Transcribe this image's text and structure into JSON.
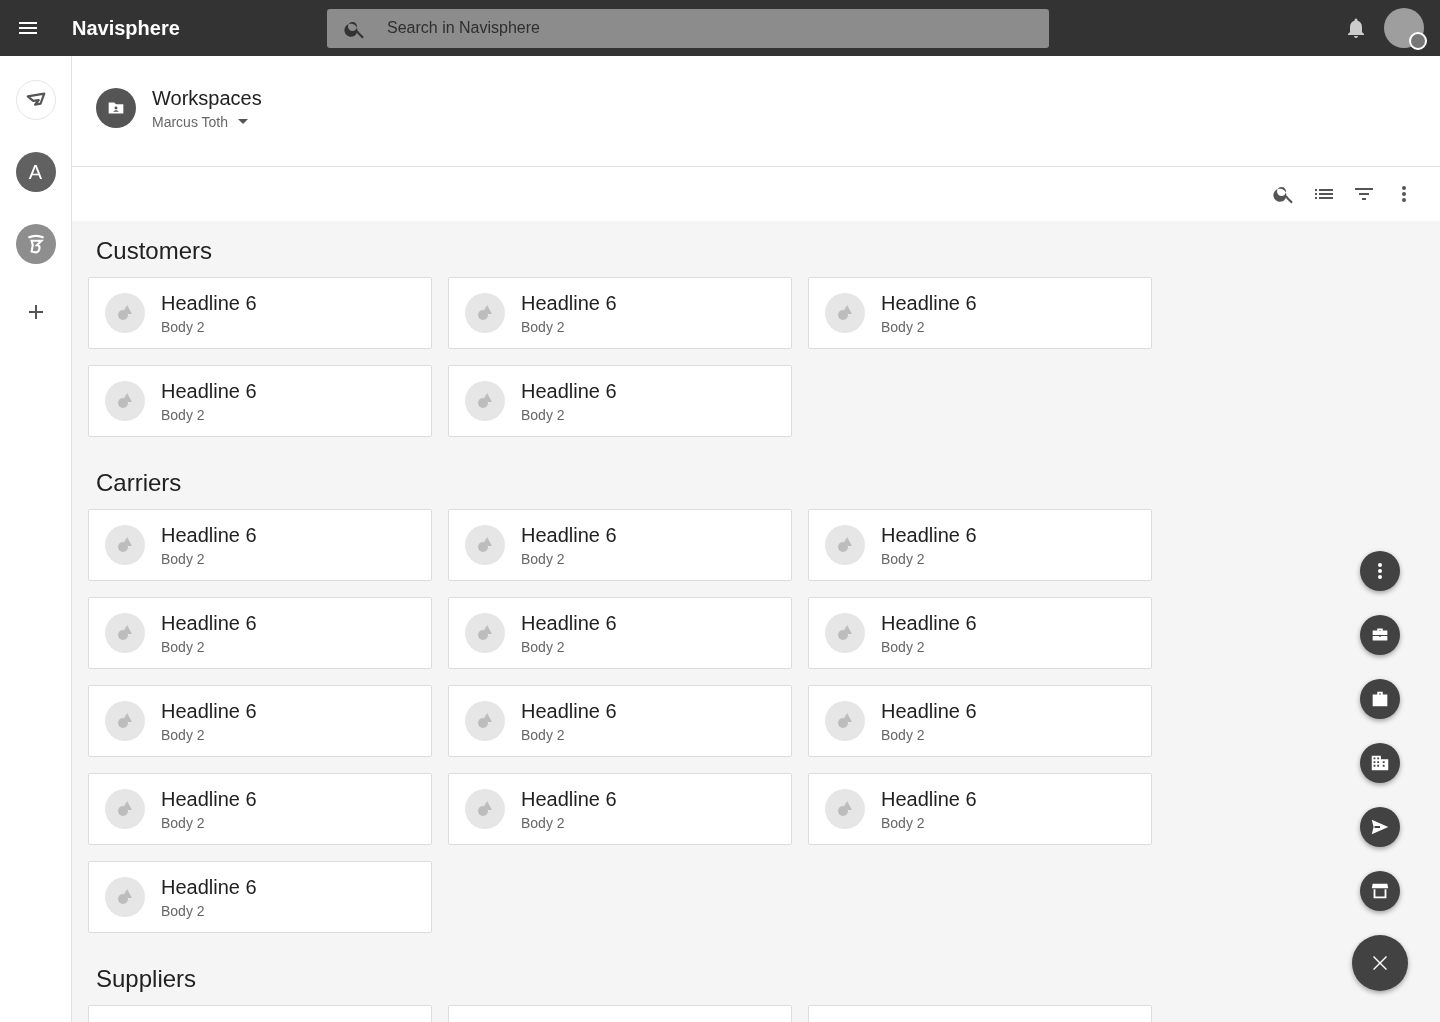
{
  "app_bar": {
    "title": "Navisphere",
    "search": {
      "placeholder": "Search in Navisphere"
    }
  },
  "sidebar": {
    "items": [
      {
        "kind": "logo"
      },
      {
        "kind": "letter",
        "label": "A"
      },
      {
        "kind": "badge"
      },
      {
        "kind": "add"
      }
    ]
  },
  "header": {
    "title": "Workspaces",
    "subtitle": "Marcus Toth"
  },
  "sections": [
    {
      "title": "Customers",
      "cards": [
        {
          "kind": "full",
          "headline": "Headline 6",
          "body": "Body 2"
        },
        {
          "kind": "full",
          "headline": "Headline 6",
          "body": "Body 2"
        },
        {
          "kind": "full",
          "headline": "Headline 6",
          "body": "Body 2"
        },
        {
          "kind": "full",
          "headline": "Headline 6",
          "body": "Body 2"
        },
        {
          "kind": "full",
          "headline": "Headline 6",
          "body": "Body 2"
        }
      ]
    },
    {
      "title": "Carriers",
      "cards": [
        {
          "kind": "full",
          "headline": "Headline 6",
          "body": "Body 2"
        },
        {
          "kind": "full",
          "headline": "Headline 6",
          "body": "Body 2"
        },
        {
          "kind": "full",
          "headline": "Headline 6",
          "body": "Body 2"
        },
        {
          "kind": "full",
          "headline": "Headline 6",
          "body": "Body 2"
        },
        {
          "kind": "full",
          "headline": "Headline 6",
          "body": "Body 2"
        },
        {
          "kind": "full",
          "headline": "Headline 6",
          "body": "Body 2"
        },
        {
          "kind": "full",
          "headline": "Headline 6",
          "body": "Body 2"
        },
        {
          "kind": "full",
          "headline": "Headline 6",
          "body": "Body 2"
        },
        {
          "kind": "full",
          "headline": "Headline 6",
          "body": "Body 2"
        },
        {
          "kind": "full",
          "headline": "Headline 6",
          "body": "Body 2"
        },
        {
          "kind": "full",
          "headline": "Headline 6",
          "body": "Body 2"
        },
        {
          "kind": "full",
          "headline": "Headline 6",
          "body": "Body 2"
        },
        {
          "kind": "full",
          "headline": "Headline 6",
          "body": "Body 2"
        }
      ]
    },
    {
      "title": "Suppliers",
      "cards": [
        {
          "kind": "cut"
        },
        {
          "kind": "cut"
        },
        {
          "kind": "cut"
        }
      ]
    }
  ],
  "fab_menu": {
    "actions": [
      {
        "kind": "more"
      },
      {
        "kind": "toolbox"
      },
      {
        "kind": "briefcase"
      },
      {
        "kind": "building"
      },
      {
        "kind": "send"
      },
      {
        "kind": "store"
      }
    ]
  }
}
